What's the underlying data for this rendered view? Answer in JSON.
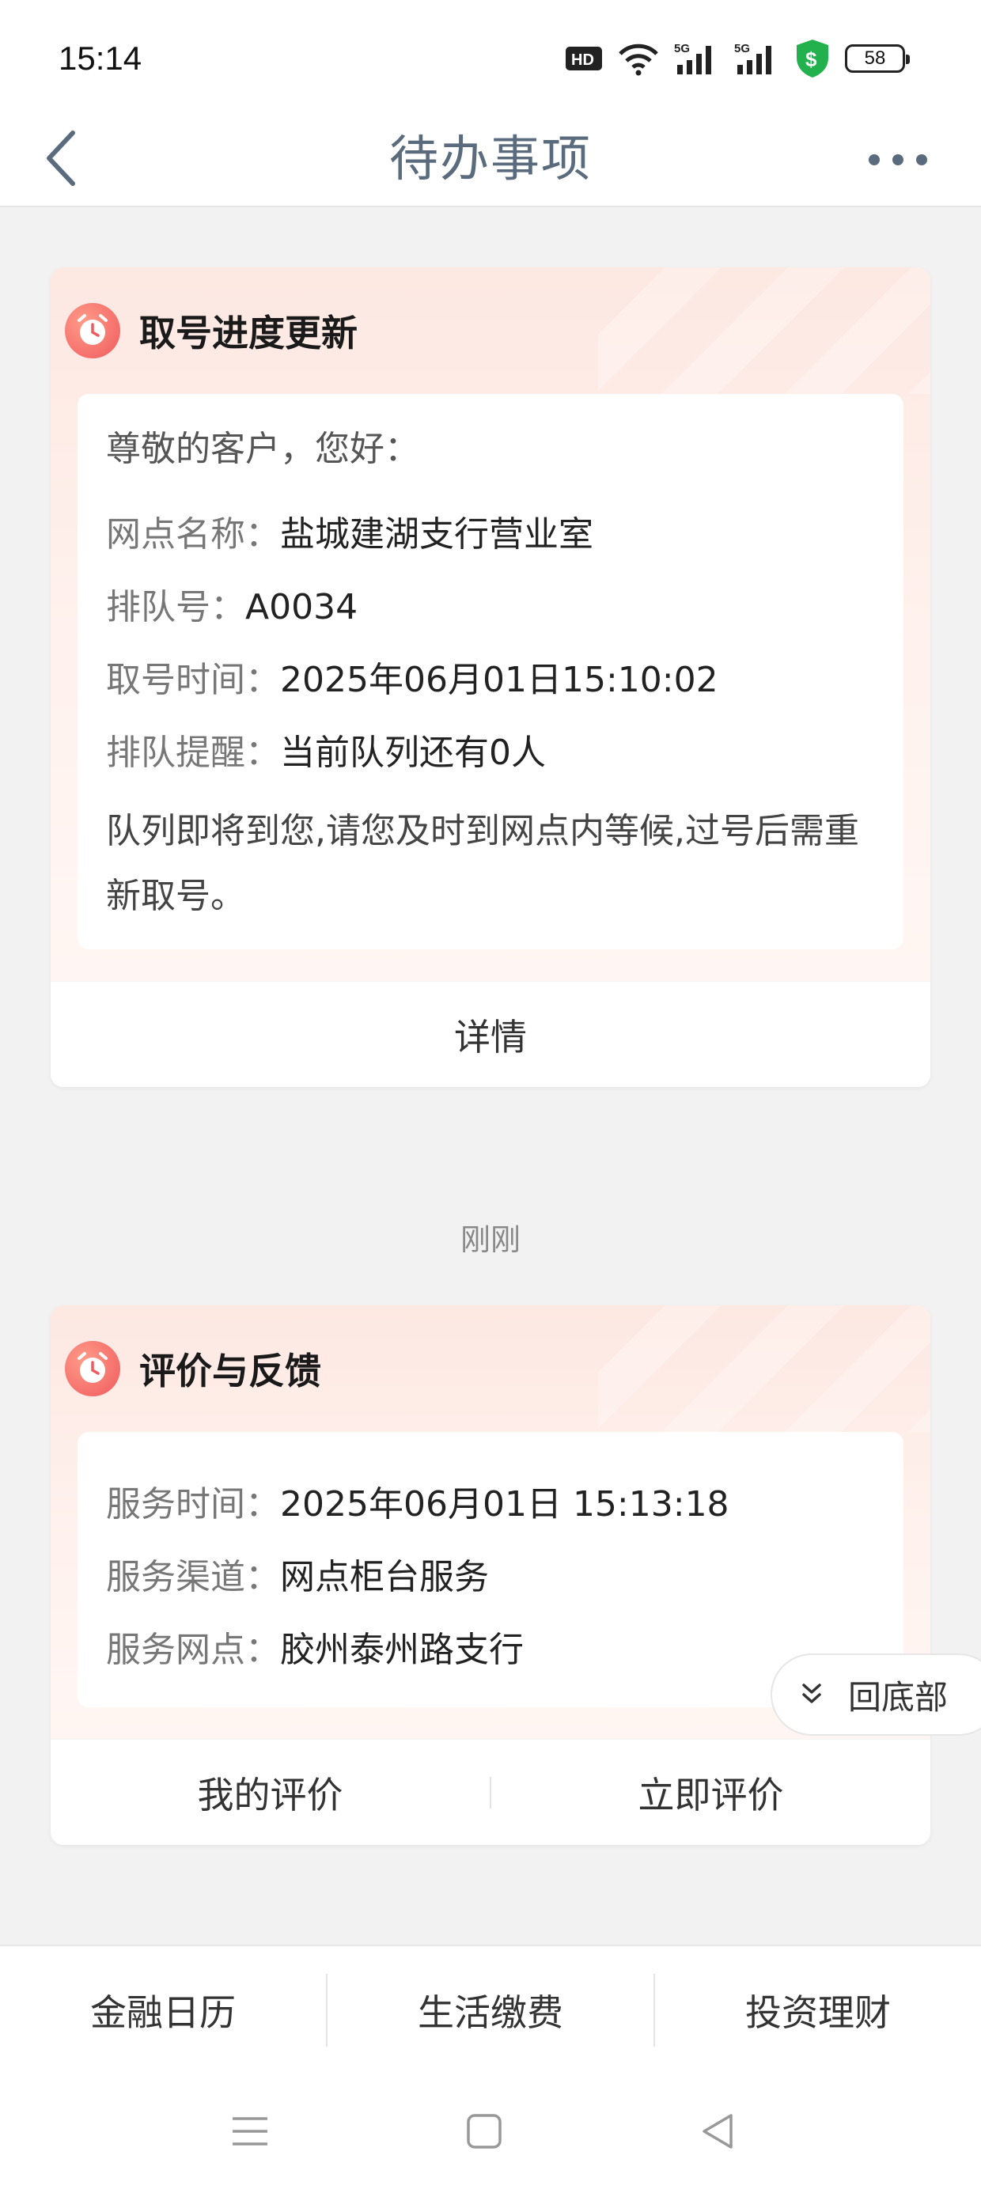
{
  "status_bar": {
    "time": "15:14",
    "icons": [
      "hd-icon",
      "wifi-icon",
      "5g-signal-icon",
      "5g-signal-icon",
      "shield-dollar-icon",
      "battery-icon"
    ],
    "battery": "58"
  },
  "nav": {
    "title": "待办事项",
    "back_icon": "chevron-left-icon",
    "more_icon": "more-dots-icon"
  },
  "card1": {
    "title": "取号进度更新",
    "greeting": "尊敬的客户，您好：",
    "rows": [
      {
        "label": "网点名称：",
        "value": "盐城建湖支行营业室"
      },
      {
        "label": "排队号：",
        "value": "A0034"
      },
      {
        "label": "取号时间：",
        "value": "2025年06月01日15:10:02"
      },
      {
        "label": "排队提醒：",
        "value": "当前队列还有0人"
      }
    ],
    "notice": "队列即将到您,请您及时到网点内等候,过号后需重新取号。",
    "footer_button": "详情"
  },
  "timestamp2": "刚刚",
  "card2": {
    "title": "评价与反馈",
    "rows": [
      {
        "label": "服务时间：",
        "value": "2025年06月01日 15:13:18"
      },
      {
        "label": "服务渠道：",
        "value": "网点柜台服务"
      },
      {
        "label": "服务网点：",
        "value": "胶州泰州路支行"
      }
    ],
    "button_left": "我的评价",
    "button_right": "立即评价"
  },
  "to_bottom": "回底部",
  "tabs": [
    "金融日历",
    "生活缴费",
    "投资理财"
  ],
  "colors": {
    "accent_red": "#f05a5e",
    "title_gray": "#5a6b7d",
    "card_gradient_top": "#fde8e2"
  }
}
